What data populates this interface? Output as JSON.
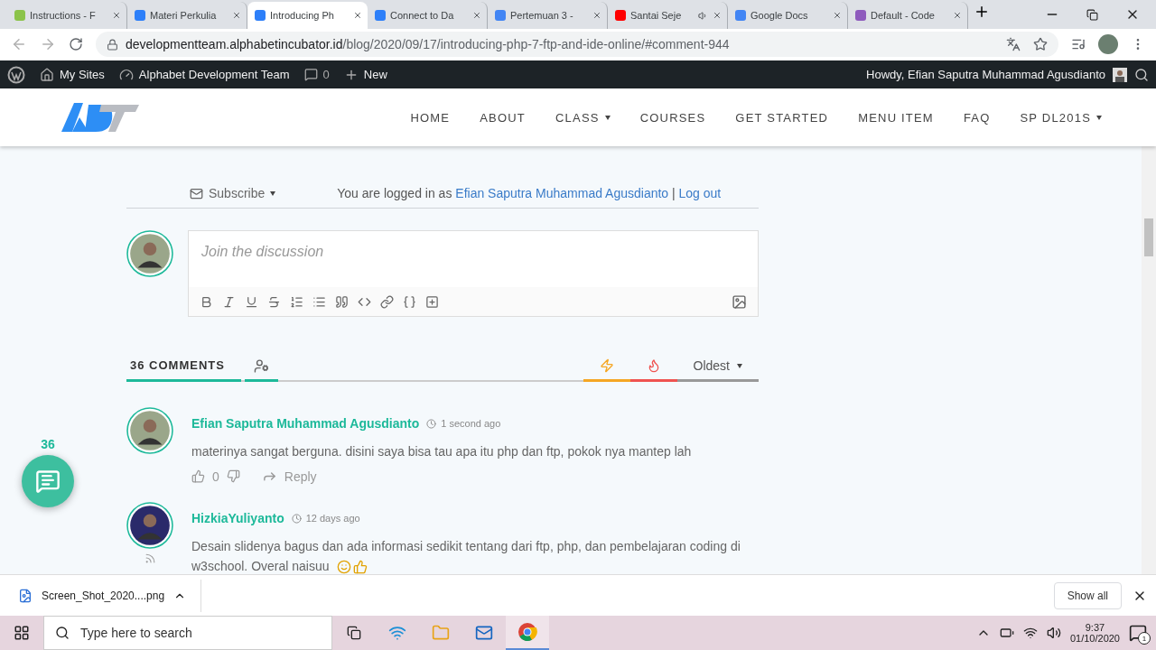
{
  "browser": {
    "tabs": [
      {
        "title": "Instructions - F",
        "color": "#8bc34a",
        "audio": false,
        "selected": false
      },
      {
        "title": "Materi Perkulia",
        "color": "#2d7ff9",
        "audio": false,
        "selected": false
      },
      {
        "title": "Introducing Ph",
        "color": "#2d7ff9",
        "audio": false,
        "selected": true
      },
      {
        "title": "Connect to Da",
        "color": "#2d7ff9",
        "audio": false,
        "selected": false
      },
      {
        "title": "Pertemuan 3 -",
        "color": "#4285f4",
        "audio": false,
        "selected": false
      },
      {
        "title": "Santai Seje",
        "color": "#ff0000",
        "audio": true,
        "selected": false
      },
      {
        "title": "Google Docs",
        "color": "#4285f4",
        "audio": false,
        "selected": false
      },
      {
        "title": "Default - Code",
        "color": "#8e5bbd",
        "audio": false,
        "selected": false
      }
    ],
    "url_host": "developmentteam.alphabetincubator.id",
    "url_path": "/blog/2020/09/17/introducing-php-7-ftp-and-ide-online/#comment-944"
  },
  "admin_bar": {
    "my_sites": "My Sites",
    "site": "Alphabet Development Team",
    "comments": "0",
    "new": "New",
    "howdy": "Howdy, Efian Saputra Muhammad Agusdianto"
  },
  "nav": [
    {
      "label": "HOME",
      "dropdown": false
    },
    {
      "label": "ABOUT",
      "dropdown": false
    },
    {
      "label": "CLASS",
      "dropdown": true
    },
    {
      "label": "COURSES",
      "dropdown": false
    },
    {
      "label": "GET STARTED",
      "dropdown": false
    },
    {
      "label": "MENU ITEM",
      "dropdown": false
    },
    {
      "label": "FAQ",
      "dropdown": false
    },
    {
      "label": "SP DL201S",
      "dropdown": true
    }
  ],
  "subscribe": "Subscribe",
  "logged_in": {
    "prefix": "You are logged in as",
    "user": "Efian Saputra Muhammad Agusdianto",
    "separator": "|",
    "logout": "Log out"
  },
  "editor": {
    "placeholder": "Join the discussion"
  },
  "comments_header": {
    "count": "36 COMMENTS",
    "sort": [
      {
        "kind": "newest"
      },
      {
        "kind": "popular"
      },
      {
        "kind": "oldest",
        "label": "Oldest"
      }
    ]
  },
  "floating": {
    "count": "36"
  },
  "comments": [
    {
      "author": "Efian Saputra Muhammad Agusdianto",
      "time": "1 second ago",
      "text": "materinya sangat berguna. disini saya bisa tau apa itu php dan ftp, pokok nya mantep lah",
      "votes": "0",
      "reply": "Reply",
      "emoji": false,
      "rss": false
    },
    {
      "author": "HizkiaYuliyanto",
      "time": "12 days ago",
      "text": "Desain slidenya bagus dan ada informasi sedikit tentang dari ftp, php, dan pembelajaran coding di w3school. Overal naisuu",
      "emoji": true,
      "rss": true
    }
  ],
  "download": {
    "file": "Screen_Shot_2020....png",
    "show_all": "Show all"
  },
  "taskbar": {
    "search_placeholder": "Type here to search",
    "time": "9:37",
    "date": "01/10/2020",
    "notifications": "1"
  }
}
